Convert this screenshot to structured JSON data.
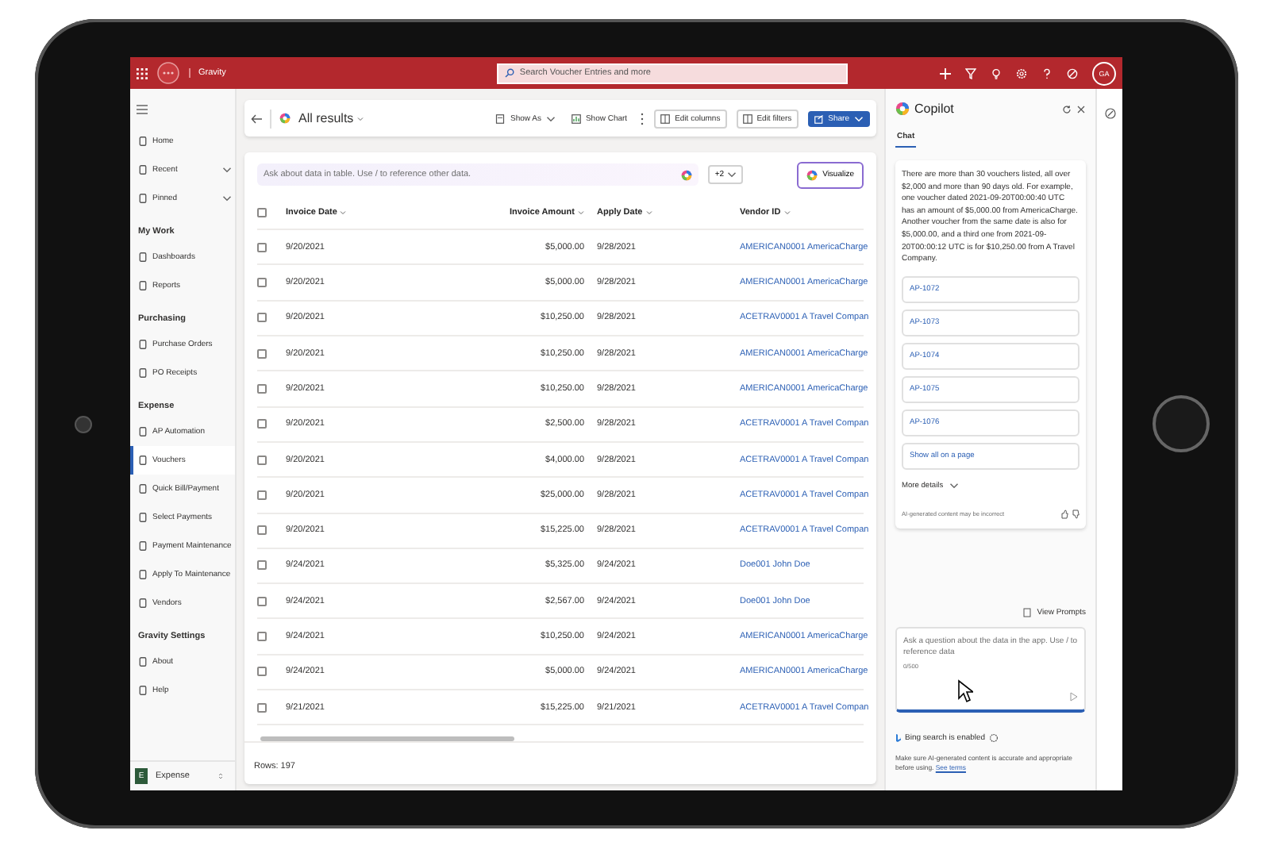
{
  "app_bar": {
    "app_name": "Gravity",
    "search": {
      "placeholder": "Search Voucher Entries and more"
    },
    "avatar": "GA"
  },
  "sidebar": {
    "top_items": [
      {
        "label": "Home",
        "expandable": false
      },
      {
        "label": "Recent",
        "expandable": true
      },
      {
        "label": "Pinned",
        "expandable": true
      }
    ],
    "sections": [
      {
        "heading": "My Work",
        "items": [
          {
            "label": "Dashboards",
            "selected": false
          },
          {
            "label": "Reports",
            "selected": false
          }
        ]
      },
      {
        "heading": "Purchasing",
        "items": [
          {
            "label": "Purchase Orders",
            "selected": false
          },
          {
            "label": "PO Receipts",
            "selected": false
          }
        ]
      },
      {
        "heading": "Expense",
        "items": [
          {
            "label": "AP Automation",
            "selected": false
          },
          {
            "label": "Vouchers",
            "selected": true
          },
          {
            "label": "Quick Bill/Payment",
            "selected": false
          },
          {
            "label": "Select Payments",
            "selected": false
          },
          {
            "label": "Payment Maintenance",
            "selected": false
          },
          {
            "label": "Apply To Maintenance",
            "selected": false
          },
          {
            "label": "Vendors",
            "selected": false
          }
        ]
      },
      {
        "heading": "Gravity Settings",
        "items": [
          {
            "label": "About",
            "selected": false
          },
          {
            "label": "Help",
            "selected": false
          }
        ]
      }
    ],
    "area": {
      "badge": "E",
      "label": "Expense"
    }
  },
  "view": {
    "title": "All results",
    "commands": [
      {
        "kind": "dropdown",
        "label": "Show As"
      },
      {
        "kind": "plain",
        "label": "Show Chart"
      },
      {
        "kind": "overflow"
      },
      {
        "kind": "outlined",
        "label": "Edit columns"
      },
      {
        "kind": "outlined",
        "label": "Edit filters"
      },
      {
        "kind": "primary",
        "label": "Share"
      }
    ]
  },
  "ask_bar": {
    "placeholder": "Ask about data in table. Use / to reference other data.",
    "scope": "+2",
    "visualize": "Visualize"
  },
  "table": {
    "all_selected": false,
    "columns": [
      {
        "label": "Invoice Date"
      },
      {
        "label": "Invoice Amount"
      },
      {
        "label": "Apply Date"
      },
      {
        "label": "Vendor ID"
      }
    ],
    "rows": [
      {
        "selected": false,
        "cells": [
          "9/20/2021",
          "$5,000.00",
          "9/28/2021",
          "AMERICAN0001 AmericaCharge"
        ]
      },
      {
        "selected": false,
        "cells": [
          "9/20/2021",
          "$5,000.00",
          "9/28/2021",
          "AMERICAN0001 AmericaCharge"
        ]
      },
      {
        "selected": false,
        "cells": [
          "9/20/2021",
          "$10,250.00",
          "9/28/2021",
          "ACETRAV0001 A Travel Compan"
        ]
      },
      {
        "selected": false,
        "cells": [
          "9/20/2021",
          "$10,250.00",
          "9/28/2021",
          "AMERICAN0001 AmericaCharge"
        ]
      },
      {
        "selected": false,
        "cells": [
          "9/20/2021",
          "$10,250.00",
          "9/28/2021",
          "AMERICAN0001 AmericaCharge"
        ]
      },
      {
        "selected": false,
        "cells": [
          "9/20/2021",
          "$2,500.00",
          "9/28/2021",
          "ACETRAV0001 A Travel Compan"
        ]
      },
      {
        "selected": false,
        "cells": [
          "9/20/2021",
          "$4,000.00",
          "9/28/2021",
          "ACETRAV0001 A Travel Compan"
        ]
      },
      {
        "selected": false,
        "cells": [
          "9/20/2021",
          "$25,000.00",
          "9/28/2021",
          "ACETRAV0001 A Travel Compan"
        ]
      },
      {
        "selected": false,
        "cells": [
          "9/20/2021",
          "$15,225.00",
          "9/28/2021",
          "ACETRAV0001 A Travel Compan"
        ]
      },
      {
        "selected": false,
        "cells": [
          "9/24/2021",
          "$5,325.00",
          "9/24/2021",
          "Doe001 John Doe"
        ]
      },
      {
        "selected": false,
        "cells": [
          "9/24/2021",
          "$2,567.00",
          "9/24/2021",
          "Doe001 John Doe"
        ]
      },
      {
        "selected": false,
        "cells": [
          "9/24/2021",
          "$10,250.00",
          "9/24/2021",
          "AMERICAN0001 AmericaCharge"
        ]
      },
      {
        "selected": false,
        "cells": [
          "9/24/2021",
          "$5,000.00",
          "9/24/2021",
          "AMERICAN0001 AmericaCharge"
        ]
      },
      {
        "selected": false,
        "cells": [
          "9/21/2021",
          "$15,225.00",
          "9/21/2021",
          "ACETRAV0001 A Travel Compan"
        ]
      }
    ],
    "footer": "Rows: 197"
  },
  "copilot": {
    "title": "Copilot",
    "tabs": [
      {
        "label": "Chat",
        "selected": true
      }
    ],
    "message": "There are more than 30 vouchers listed, all over $2,000 and more than 90 days old. For example, one voucher dated 2021-09-20T00:00:40 UTC has an amount of $5,000.00 from AmericaCharge. Another voucher from the same date is also for $5,000.00, and a third one from 2021-09-20T00:00:12 UTC is for $10,250.00 from A Travel Company.",
    "links": [
      "AP-1072",
      "AP-1073",
      "AP-1074",
      "AP-1075",
      "AP-1076",
      "Show all on a page"
    ],
    "more_details": "More details",
    "ai_notice": "AI-generated content may be incorrect",
    "view_prompts": "View Prompts",
    "input": {
      "placeholder": "Ask a question about the data in the app. Use / to reference data",
      "counter": "0/500"
    },
    "bing": "Bing search is enabled",
    "disclaimer": "Make sure AI-generated content is accurate and appropriate before using.",
    "terms_link": "See terms"
  }
}
